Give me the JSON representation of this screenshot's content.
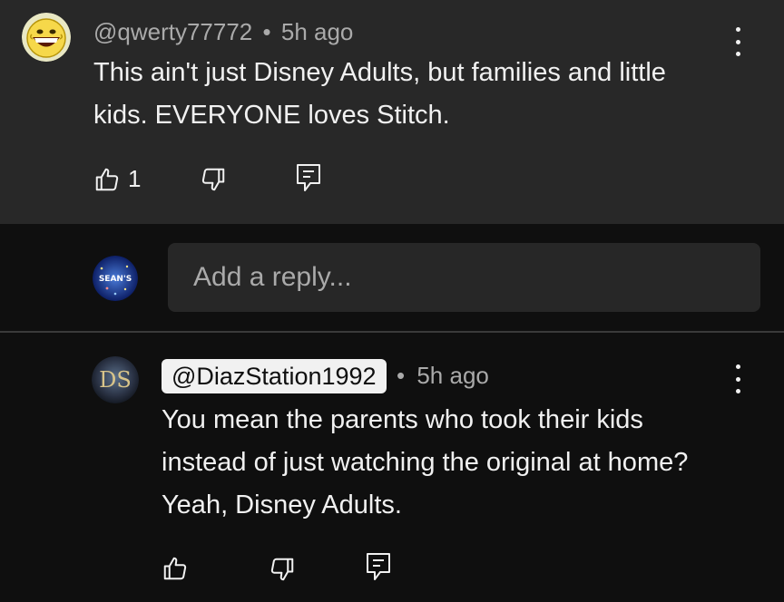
{
  "comment": {
    "author": "@qwerty77772",
    "separator": "•",
    "time": "5h ago",
    "text": "This ain't just Disney Adults, but families and little kids. EVERYONE loves Stitch.",
    "like_count": "1",
    "avatar_icon": "smiley-face-icon"
  },
  "reply_input": {
    "placeholder": "Add a reply...",
    "avatar_text": "SEAN'S"
  },
  "reply": {
    "author": "@DiazStation1992",
    "separator": "•",
    "time": "5h ago",
    "text": "You mean the parents who took their kids instead of just watching the original at home? Yeah, Disney Adults.",
    "avatar_text": "DS"
  },
  "colors": {
    "top_background": "#282828",
    "page_background": "#0f0f0f",
    "text_primary": "#f1f1f1",
    "text_secondary": "#aaaaaa",
    "input_background": "#272727"
  }
}
